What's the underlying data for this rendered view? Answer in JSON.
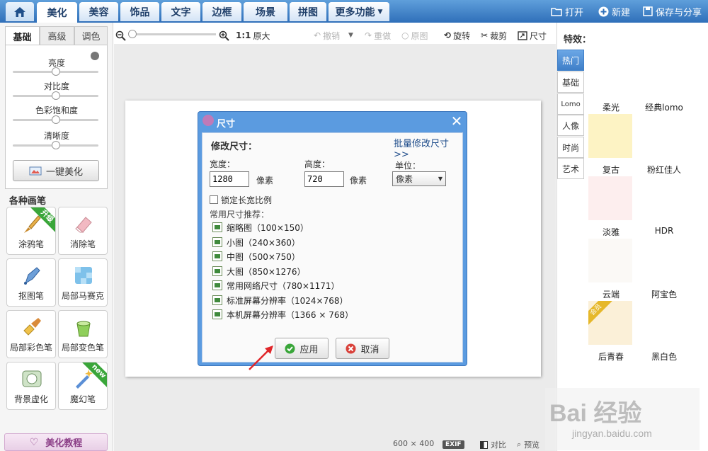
{
  "nav": {
    "tabs": [
      "美化",
      "美容",
      "饰品",
      "文字",
      "边框",
      "场景",
      "拼图",
      "更多功能"
    ],
    "actions": {
      "open": "打开",
      "new": "新建",
      "save": "保存与分享"
    }
  },
  "left": {
    "subtabs": [
      "基础",
      "高级",
      "调色"
    ],
    "adjust": [
      {
        "label": "亮度",
        "level": 0.5
      },
      {
        "label": "对比度",
        "level": 0.5
      },
      {
        "label": "色彩饱和度",
        "level": 0.5
      },
      {
        "label": "清晰度",
        "level": 0.5
      }
    ],
    "one_key": "一键美化",
    "brush_title": "各种画笔",
    "brushes": [
      {
        "label": "涂鸦笔",
        "badge": "升级"
      },
      {
        "label": "消除笔",
        "badge": ""
      },
      {
        "label": "抠图笔",
        "badge": ""
      },
      {
        "label": "局部马赛克",
        "badge": ""
      },
      {
        "label": "局部彩色笔",
        "badge": ""
      },
      {
        "label": "局部变色笔",
        "badge": ""
      },
      {
        "label": "背景虚化",
        "badge": ""
      },
      {
        "label": "魔幻笔",
        "badge": "new"
      }
    ],
    "tutorial": "美化教程"
  },
  "toolbar": {
    "ratio": "1:1",
    "original_size": "原大",
    "undo": "撤销",
    "redo": "重做",
    "original": "原图",
    "rotate": "旋转",
    "crop": "裁剪",
    "size": "尺寸"
  },
  "dialog": {
    "title": "尺寸",
    "section": "修改尺寸：",
    "batch_link": "批量修改尺寸>>",
    "width_label": "宽度：",
    "width_value": "1280",
    "height_label": "高度：",
    "height_value": "720",
    "unit_suffix": "像素",
    "unit_label": "单位：",
    "unit_value": "像素",
    "lock_ratio": "锁定长宽比例",
    "presets_title": "常用尺寸推荐：",
    "presets": [
      "缩略图（100×150）",
      "小图（240×360）",
      "中图（500×750）",
      "大图（850×1276）",
      "常用网络尺寸（780×1171）",
      "标准屏幕分辨率（1024×768）",
      "本机屏幕分辨率（1366 × 768）"
    ],
    "apply": "应用",
    "cancel": "取消"
  },
  "right": {
    "title": "特效：",
    "tabs": [
      "热门",
      "基础",
      "Lomo",
      "人像",
      "时尚",
      "艺术"
    ],
    "effects": [
      {
        "label": "柔光",
        "color": "#fdf3c4"
      },
      {
        "label": "经典lomo",
        "color": "#ffffff"
      },
      {
        "label": "复古",
        "color": "#fdeeee"
      },
      {
        "label": "粉红佳人",
        "color": "#ffffff"
      },
      {
        "label": "淡雅",
        "color": "#fbf9f6"
      },
      {
        "label": "HDR",
        "color": "#ffffff"
      },
      {
        "label": "云端",
        "color": "#fbf0d8"
      },
      {
        "label": "阿宝色",
        "color": "#ffffff"
      },
      {
        "label": "后青春",
        "color": "#ffffff"
      },
      {
        "label": "黑白色",
        "color": "#ffffff"
      }
    ],
    "vip_badge": "会员"
  },
  "status": {
    "size": "600 × 400",
    "exif": "EXIF",
    "compare": "对比",
    "preview": "预览"
  },
  "watermark": {
    "brand": "Bai 经验",
    "url": "jingyan.baidu.com"
  }
}
